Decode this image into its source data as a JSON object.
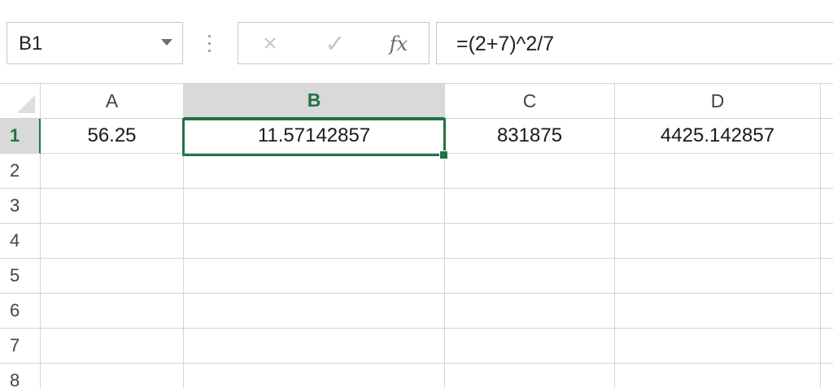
{
  "formula_bar": {
    "name_box": "B1",
    "cancel_icon": "×",
    "enter_icon": "✓",
    "insert_function_label": "fx",
    "formula": "=(2+7)^2/7"
  },
  "columns": [
    "A",
    "B",
    "C",
    "D"
  ],
  "selected_column": "B",
  "rows": [
    "1",
    "2",
    "3",
    "4",
    "5",
    "6",
    "7",
    "8"
  ],
  "selected_row": "1",
  "cells": {
    "A1": "56.25",
    "B1": "11.57142857",
    "C1": "831875",
    "D1": "4425.142857"
  },
  "active_cell": "B1",
  "colors": {
    "accent": "#217346",
    "header_selected_bg": "#d9d9d9",
    "grid_line": "#d4d4d4"
  },
  "icons": {
    "name_box_dropdown": "chevron-down-icon",
    "cancel": "close-icon",
    "enter": "checkmark-icon",
    "insert_function": "function-icon",
    "grip": "vertical-dots-icon",
    "select_all": "select-all-triangle-icon"
  }
}
